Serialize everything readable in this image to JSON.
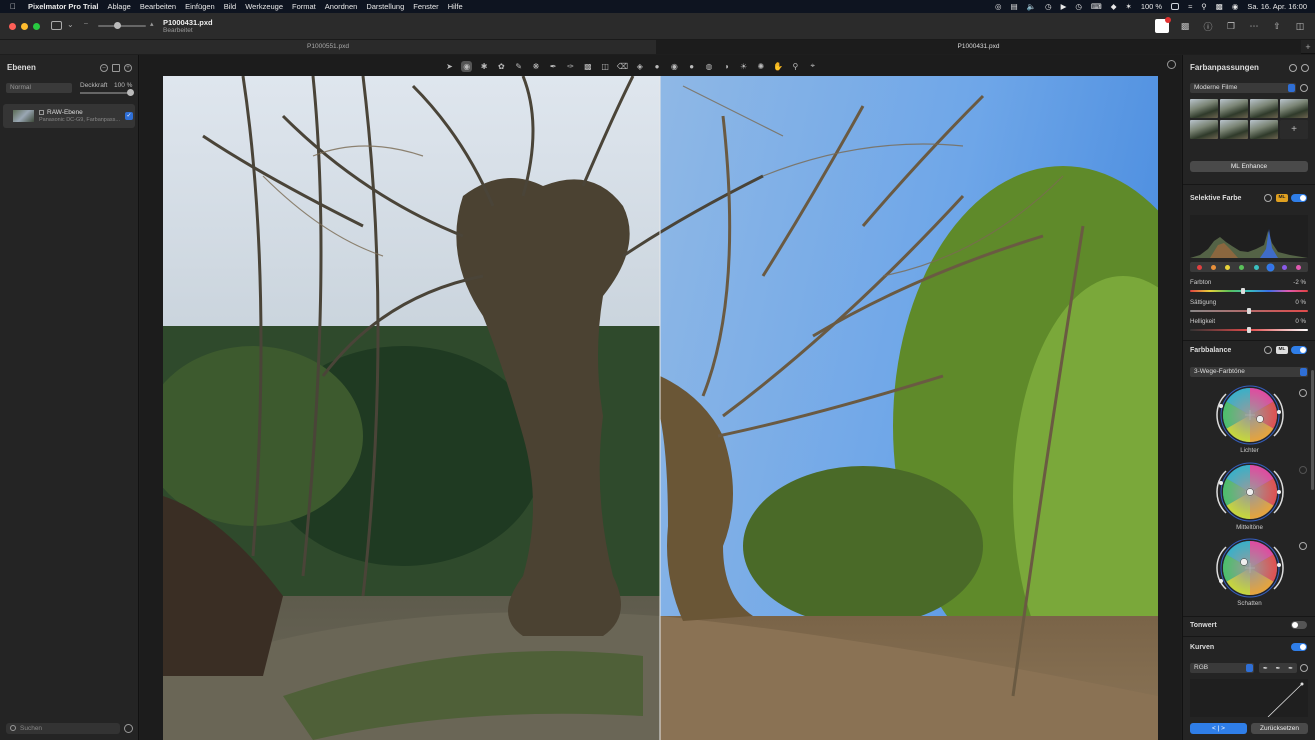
{
  "menubar": {
    "app_name": "Pixelmator Pro Trial",
    "items": [
      "Ablage",
      "Bearbeiten",
      "Einfügen",
      "Bild",
      "Werkzeuge",
      "Format",
      "Anordnen",
      "Darstellung",
      "Fenster",
      "Hilfe"
    ],
    "battery": "100 %",
    "datetime": "Sa. 16. Apr.  16:00"
  },
  "titlebar": {
    "doc_title": "P1000431.pxd",
    "doc_subtitle": "Bearbeitet"
  },
  "tabs": [
    {
      "label": "P1000551.pxd",
      "active": false
    },
    {
      "label": "P1000431.pxd",
      "active": true
    }
  ],
  "layers_panel": {
    "title": "Ebenen",
    "blend_mode": "Normal",
    "opacity_label": "Deckkraft",
    "opacity_value": "100 %",
    "opacity": 1.0,
    "layer": {
      "name": "RAW-Ebene",
      "subtitle": "Panasonic DC-G9, Farbanpass..."
    },
    "search_placeholder": "Suchen"
  },
  "adjustments_panel": {
    "title": "Farbanpassungen",
    "preset_collection": "Moderne Filme",
    "ml_enhance_label": "ML Enhance",
    "selective_color": {
      "title": "Selektive Farbe",
      "ml_badge": "ML",
      "enabled": true,
      "swatch_colors": [
        "#e04040",
        "#e8903a",
        "#e8d33a",
        "#5ac05a",
        "#3ac0c0",
        "#3a6ee8",
        "#8a5ae8",
        "#e05ab0"
      ],
      "selected_swatch": 5,
      "rows": [
        {
          "label": "Farbton",
          "value": "-2 %",
          "fraction": 0.45,
          "track": "hue"
        },
        {
          "label": "Sättigung",
          "value": "0 %",
          "fraction": 0.5,
          "track": "sat"
        },
        {
          "label": "Helligkeit",
          "value": "0 %",
          "fraction": 0.5,
          "track": "light"
        }
      ]
    },
    "color_balance": {
      "title": "Farbbalance",
      "ml_badge": "ML",
      "enabled": true,
      "mode": "3-Wege-Farbtöne",
      "wheels": [
        {
          "label": "Lichter"
        },
        {
          "label": "Mitteltöne"
        },
        {
          "label": "Schatten"
        }
      ]
    },
    "levels": {
      "title": "Tonwert",
      "enabled": false
    },
    "curves": {
      "title": "Kurven",
      "enabled": true,
      "channel": "RGB"
    },
    "compare_label": "< | >",
    "reset_label": "Zurücksetzen"
  },
  "colors": {
    "accent": "#2f7ee8",
    "menubar_bg": "#0e1420",
    "panel_bg": "#242424"
  }
}
